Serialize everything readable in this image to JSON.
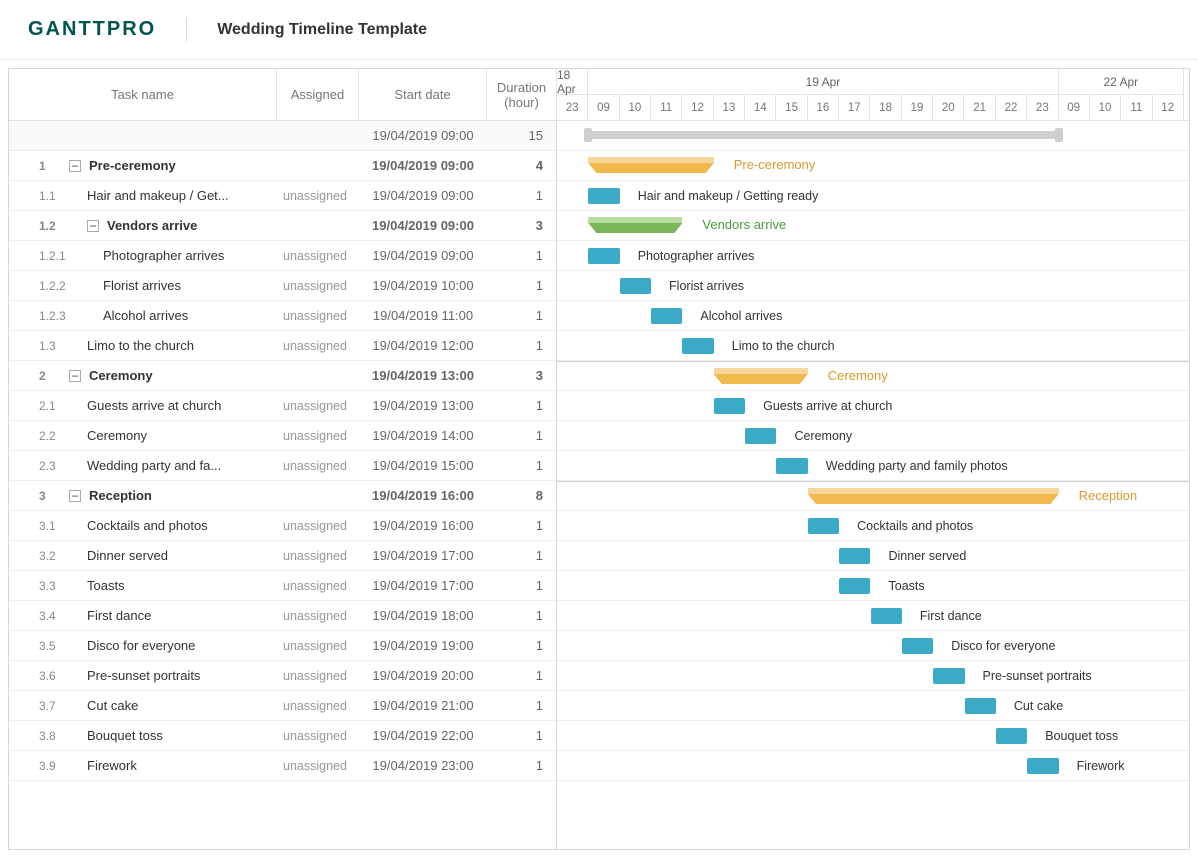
{
  "header": {
    "logo": "GANTTPRO",
    "project_title": "Wedding Timeline Template"
  },
  "columns": {
    "task": "Task name",
    "assigned": "Assigned",
    "start": "Start date",
    "duration": "Duration (hour)"
  },
  "overall": {
    "start": "19/04/2019 09:00",
    "duration": "15"
  },
  "time_header": {
    "days": [
      {
        "label": "18 Apr",
        "span_hours": 1
      },
      {
        "label": "19 Apr",
        "span_hours": 15
      },
      {
        "label": "22 Apr",
        "span_hours": 4
      }
    ],
    "hours": [
      "23",
      "09",
      "10",
      "11",
      "12",
      "13",
      "14",
      "15",
      "16",
      "17",
      "18",
      "19",
      "20",
      "21",
      "22",
      "23",
      "09",
      "10",
      "11",
      "12"
    ]
  },
  "rows": [
    {
      "num": "1",
      "level": 1,
      "group": true,
      "color": "orange",
      "name": "Pre-ceremony",
      "start": "19/04/2019 09:00",
      "dur": "4",
      "bar_start_idx": 1,
      "bar_len": 4
    },
    {
      "num": "1.1",
      "level": 2,
      "name": "Hair and makeup / Getting ready",
      "display_name": "Hair and makeup / Get...",
      "assigned": "unassigned",
      "start": "19/04/2019 09:00",
      "dur": "1",
      "bar_start_idx": 1,
      "bar_len": 1
    },
    {
      "num": "1.2",
      "level": 2,
      "group": true,
      "color": "green",
      "name": "Vendors arrive",
      "start": "19/04/2019 09:00",
      "dur": "3",
      "bar_start_idx": 1,
      "bar_len": 3
    },
    {
      "num": "1.2.1",
      "level": 3,
      "name": "Photographer arrives",
      "assigned": "unassigned",
      "start": "19/04/2019 09:00",
      "dur": "1",
      "bar_start_idx": 1,
      "bar_len": 1
    },
    {
      "num": "1.2.2",
      "level": 3,
      "name": "Florist arrives",
      "assigned": "unassigned",
      "start": "19/04/2019 10:00",
      "dur": "1",
      "bar_start_idx": 2,
      "bar_len": 1
    },
    {
      "num": "1.2.3",
      "level": 3,
      "name": "Alcohol arrives",
      "assigned": "unassigned",
      "start": "19/04/2019 11:00",
      "dur": "1",
      "bar_start_idx": 3,
      "bar_len": 1
    },
    {
      "num": "1.3",
      "level": 2,
      "name": "Limo to the church",
      "assigned": "unassigned",
      "start": "19/04/2019 12:00",
      "dur": "1",
      "bar_start_idx": 4,
      "bar_len": 1
    },
    {
      "num": "2",
      "level": 1,
      "group": true,
      "color": "orange",
      "name": "Ceremony",
      "start": "19/04/2019 13:00",
      "dur": "3",
      "bar_start_idx": 5,
      "bar_len": 3,
      "sep": true
    },
    {
      "num": "2.1",
      "level": 2,
      "name": "Guests arrive at church",
      "assigned": "unassigned",
      "start": "19/04/2019 13:00",
      "dur": "1",
      "bar_start_idx": 5,
      "bar_len": 1
    },
    {
      "num": "2.2",
      "level": 2,
      "name": "Ceremony",
      "assigned": "unassigned",
      "start": "19/04/2019 14:00",
      "dur": "1",
      "bar_start_idx": 6,
      "bar_len": 1
    },
    {
      "num": "2.3",
      "level": 2,
      "name": "Wedding party and family photos",
      "display_name": "Wedding party and fa...",
      "assigned": "unassigned",
      "start": "19/04/2019 15:00",
      "dur": "1",
      "bar_start_idx": 7,
      "bar_len": 1
    },
    {
      "num": "3",
      "level": 1,
      "group": true,
      "color": "orange",
      "name": "Reception",
      "start": "19/04/2019 16:00",
      "dur": "8",
      "bar_start_idx": 8,
      "bar_len": 8,
      "sep": true
    },
    {
      "num": "3.1",
      "level": 2,
      "name": "Cocktails and photos",
      "assigned": "unassigned",
      "start": "19/04/2019 16:00",
      "dur": "1",
      "bar_start_idx": 8,
      "bar_len": 1
    },
    {
      "num": "3.2",
      "level": 2,
      "name": "Dinner served",
      "assigned": "unassigned",
      "start": "19/04/2019 17:00",
      "dur": "1",
      "bar_start_idx": 9,
      "bar_len": 1
    },
    {
      "num": "3.3",
      "level": 2,
      "name": "Toasts",
      "assigned": "unassigned",
      "start": "19/04/2019 17:00",
      "dur": "1",
      "bar_start_idx": 9,
      "bar_len": 1
    },
    {
      "num": "3.4",
      "level": 2,
      "name": "First dance",
      "assigned": "unassigned",
      "start": "19/04/2019 18:00",
      "dur": "1",
      "bar_start_idx": 10,
      "bar_len": 1
    },
    {
      "num": "3.5",
      "level": 2,
      "name": "Disco for everyone",
      "assigned": "unassigned",
      "start": "19/04/2019 19:00",
      "dur": "1",
      "bar_start_idx": 11,
      "bar_len": 1
    },
    {
      "num": "3.6",
      "level": 2,
      "name": "Pre-sunset portraits",
      "assigned": "unassigned",
      "start": "19/04/2019 20:00",
      "dur": "1",
      "bar_start_idx": 12,
      "bar_len": 1
    },
    {
      "num": "3.7",
      "level": 2,
      "name": "Cut cake",
      "assigned": "unassigned",
      "start": "19/04/2019 21:00",
      "dur": "1",
      "bar_start_idx": 13,
      "bar_len": 1
    },
    {
      "num": "3.8",
      "level": 2,
      "name": "Bouquet toss",
      "assigned": "unassigned",
      "start": "19/04/2019 22:00",
      "dur": "1",
      "bar_start_idx": 14,
      "bar_len": 1
    },
    {
      "num": "3.9",
      "level": 2,
      "name": "Firework",
      "assigned": "unassigned",
      "start": "19/04/2019 23:00",
      "dur": "1",
      "bar_start_idx": 15,
      "bar_len": 1
    }
  ]
}
